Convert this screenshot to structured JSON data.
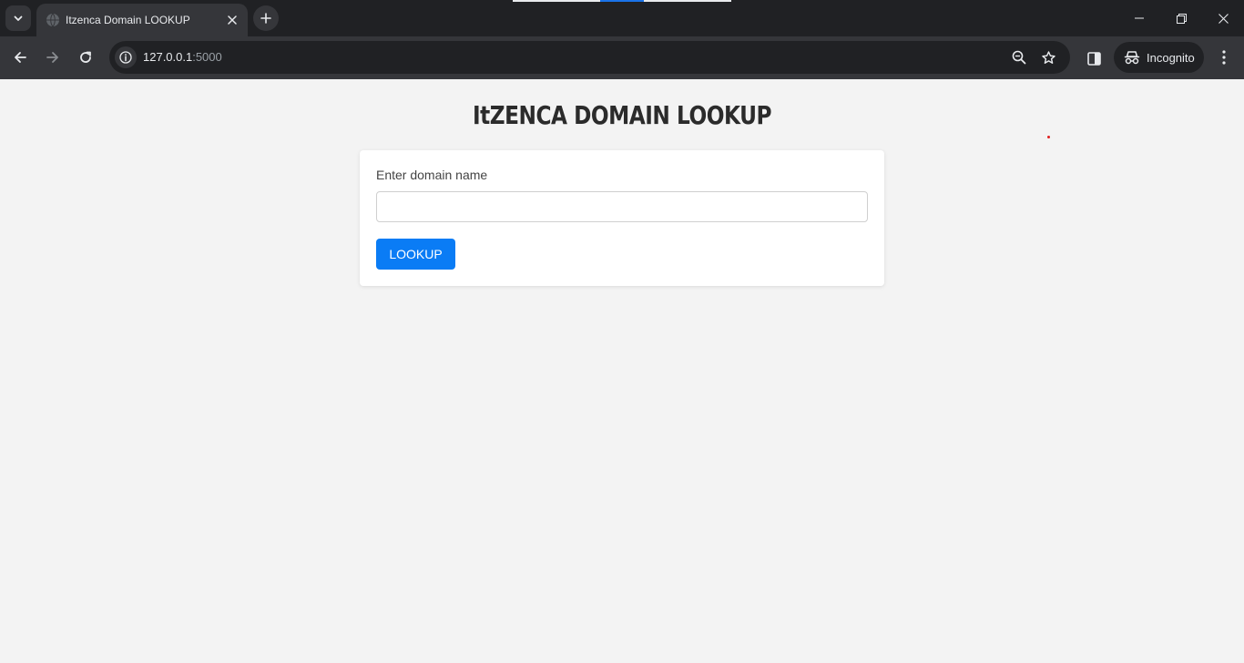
{
  "browser": {
    "tab": {
      "title": "Itzenca Domain LOOKUP",
      "favicon": "globe-icon"
    },
    "url": {
      "host": "127.0.0.1",
      "port": ":5000"
    },
    "profile": {
      "label": "Incognito"
    }
  },
  "page": {
    "title": "ItZENCA DOMAIN LOOKUP",
    "form": {
      "label": "Enter domain name",
      "input_value": "",
      "input_placeholder": "",
      "button_label": "LOOKUP"
    }
  },
  "colors": {
    "accent": "#0a7cf5",
    "page_background": "#f3f3f3",
    "chrome_dark": "#202124",
    "chrome_toolbar": "#35363a"
  }
}
